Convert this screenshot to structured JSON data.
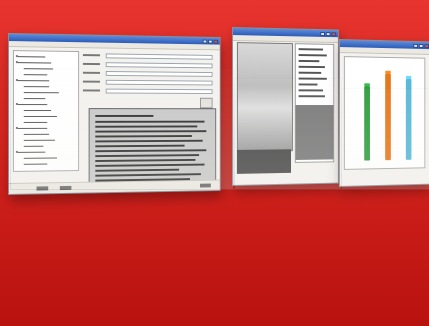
{
  "scene": {
    "background_color": "#d92720"
  },
  "windows": [
    {
      "id": "main-form-window",
      "panels": [
        "tree-view",
        "form-fields",
        "text-panel"
      ]
    },
    {
      "id": "image-viewer-window",
      "panels": [
        "image-preview",
        "file-list"
      ]
    },
    {
      "id": "chart-window",
      "panels": [
        "bar-chart"
      ]
    }
  ],
  "chart_data": {
    "type": "bar",
    "categories": [
      "",
      "",
      ""
    ],
    "series": [
      {
        "name": "",
        "values": [
          78,
          92,
          86
        ]
      }
    ],
    "colors": [
      "#2e9e3e",
      "#e8761a",
      "#59b9d8"
    ],
    "ylim": [
      0,
      100
    ]
  },
  "icons": {
    "close": "close-icon",
    "minimize": "minimize-icon",
    "maximize": "maximize-icon"
  }
}
